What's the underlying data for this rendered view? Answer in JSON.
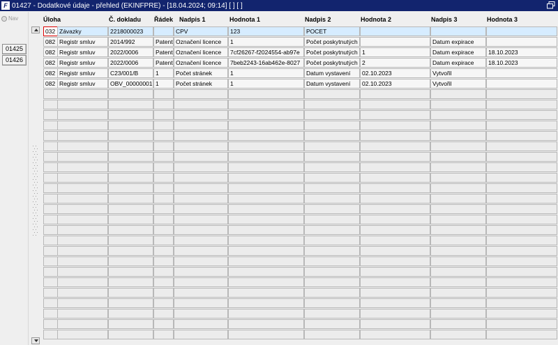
{
  "window": {
    "title": "01427 - Dodatkové údaje - přehled (EKINFPRE) - [18.04.2024; 09:14]  [ ]  [ ]",
    "app_icon": "F"
  },
  "sidebar": {
    "nav_label": "Nav",
    "buttons": [
      "01425",
      "01426"
    ]
  },
  "table": {
    "columns": [
      "Úloha",
      "",
      "Č. dokladu",
      "Řádek",
      "Nadpis 1",
      "Hodnota 1",
      "Nadpis 2",
      "Hodnota 2",
      "Nadpis 3",
      "Hodnota 3"
    ],
    "rows": [
      [
        "032",
        "Závazky",
        "2218000023",
        "",
        "CPV",
        "123",
        "POCET",
        "",
        "",
        ""
      ],
      [
        "082",
        "Registr smluv",
        "2014/992",
        "Patent",
        "Označení licence",
        "1",
        "Počet poskytnutých",
        "",
        "Datum expirace",
        ""
      ],
      [
        "082",
        "Registr smluv",
        "2022/0006",
        "Patent",
        "Označení licence",
        "7cf26267-f2024554-ab97e",
        "Počet poskytnutých",
        "1",
        "Datum expirace",
        "18.10.2023"
      ],
      [
        "082",
        "Registr smluv",
        "2022/0006",
        "Patent",
        "Označení licence",
        "7beb2243-16ab462e-8027",
        "Počet poskytnutých",
        "2",
        "Datum expirace",
        "18.10.2023"
      ],
      [
        "082",
        "Registr smluv",
        "C23/001/B",
        "1",
        "Počet stránek",
        "1",
        "Datum vystavení",
        "02.10.2023",
        "Vytvořil",
        ""
      ],
      [
        "082",
        "Registr smluv",
        "OBV_00000001",
        "1",
        "Počet stránek",
        "1",
        "Datum vystavení",
        "02.10.2023",
        "Vytvořil",
        ""
      ]
    ],
    "selected_row": 0,
    "total_visible_rows": 30
  },
  "icons": {
    "restore": "restore-window-icon",
    "scroll_up": "scroll-up-arrow-icon",
    "scroll_down": "scroll-down-arrow-icon",
    "nav": "radio-icon"
  },
  "colors": {
    "titlebar": "#12246e",
    "selected_row": "#d6ecff",
    "selected_cell_border": "#dd0000"
  }
}
